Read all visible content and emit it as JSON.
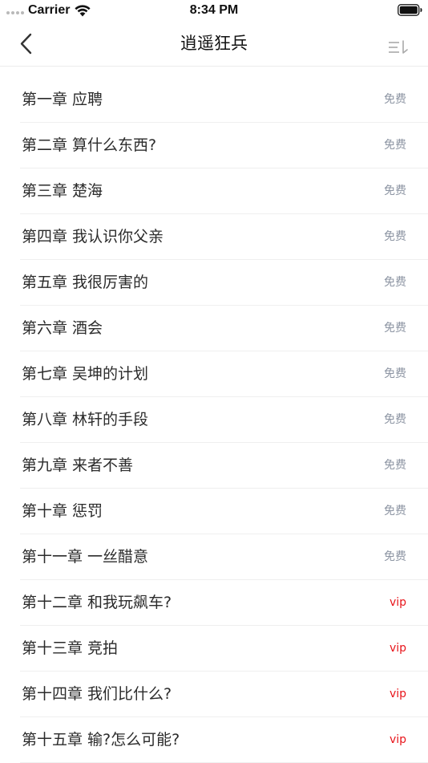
{
  "status_bar": {
    "carrier": "Carrier",
    "time": "8:34 PM",
    "wifi_icon": "wifi-icon",
    "battery_icon": "battery-icon"
  },
  "nav": {
    "title": "逍遥狂兵",
    "back_icon": "chevron-left-icon",
    "sort_icon": "sort-order-icon"
  },
  "colors": {
    "free_tag": "#8d95a3",
    "vip_tag": "#e8141a",
    "text": "#2b2b2b",
    "divider": "#efefef"
  },
  "chapters": [
    {
      "title": "第一章 应聘",
      "tag": "免费",
      "tag_type": "free"
    },
    {
      "title": "第二章 算什么东西?",
      "tag": "免费",
      "tag_type": "free"
    },
    {
      "title": "第三章 楚海",
      "tag": "免费",
      "tag_type": "free"
    },
    {
      "title": "第四章 我认识你父亲",
      "tag": "免费",
      "tag_type": "free"
    },
    {
      "title": "第五章 我很厉害的",
      "tag": "免费",
      "tag_type": "free"
    },
    {
      "title": "第六章 酒会",
      "tag": "免费",
      "tag_type": "free"
    },
    {
      "title": "第七章 吴坤的计划",
      "tag": "免费",
      "tag_type": "free"
    },
    {
      "title": "第八章 林轩的手段",
      "tag": "免费",
      "tag_type": "free"
    },
    {
      "title": "第九章 来者不善",
      "tag": "免费",
      "tag_type": "free"
    },
    {
      "title": "第十章 惩罚",
      "tag": "免费",
      "tag_type": "free"
    },
    {
      "title": "第十一章 一丝醋意",
      "tag": "免费",
      "tag_type": "free"
    },
    {
      "title": "第十二章 和我玩飙车?",
      "tag": "vip",
      "tag_type": "vip"
    },
    {
      "title": "第十三章 竞拍",
      "tag": "vip",
      "tag_type": "vip"
    },
    {
      "title": "第十四章 我们比什么?",
      "tag": "vip",
      "tag_type": "vip"
    },
    {
      "title": "第十五章 输?怎么可能?",
      "tag": "vip",
      "tag_type": "vip"
    }
  ]
}
